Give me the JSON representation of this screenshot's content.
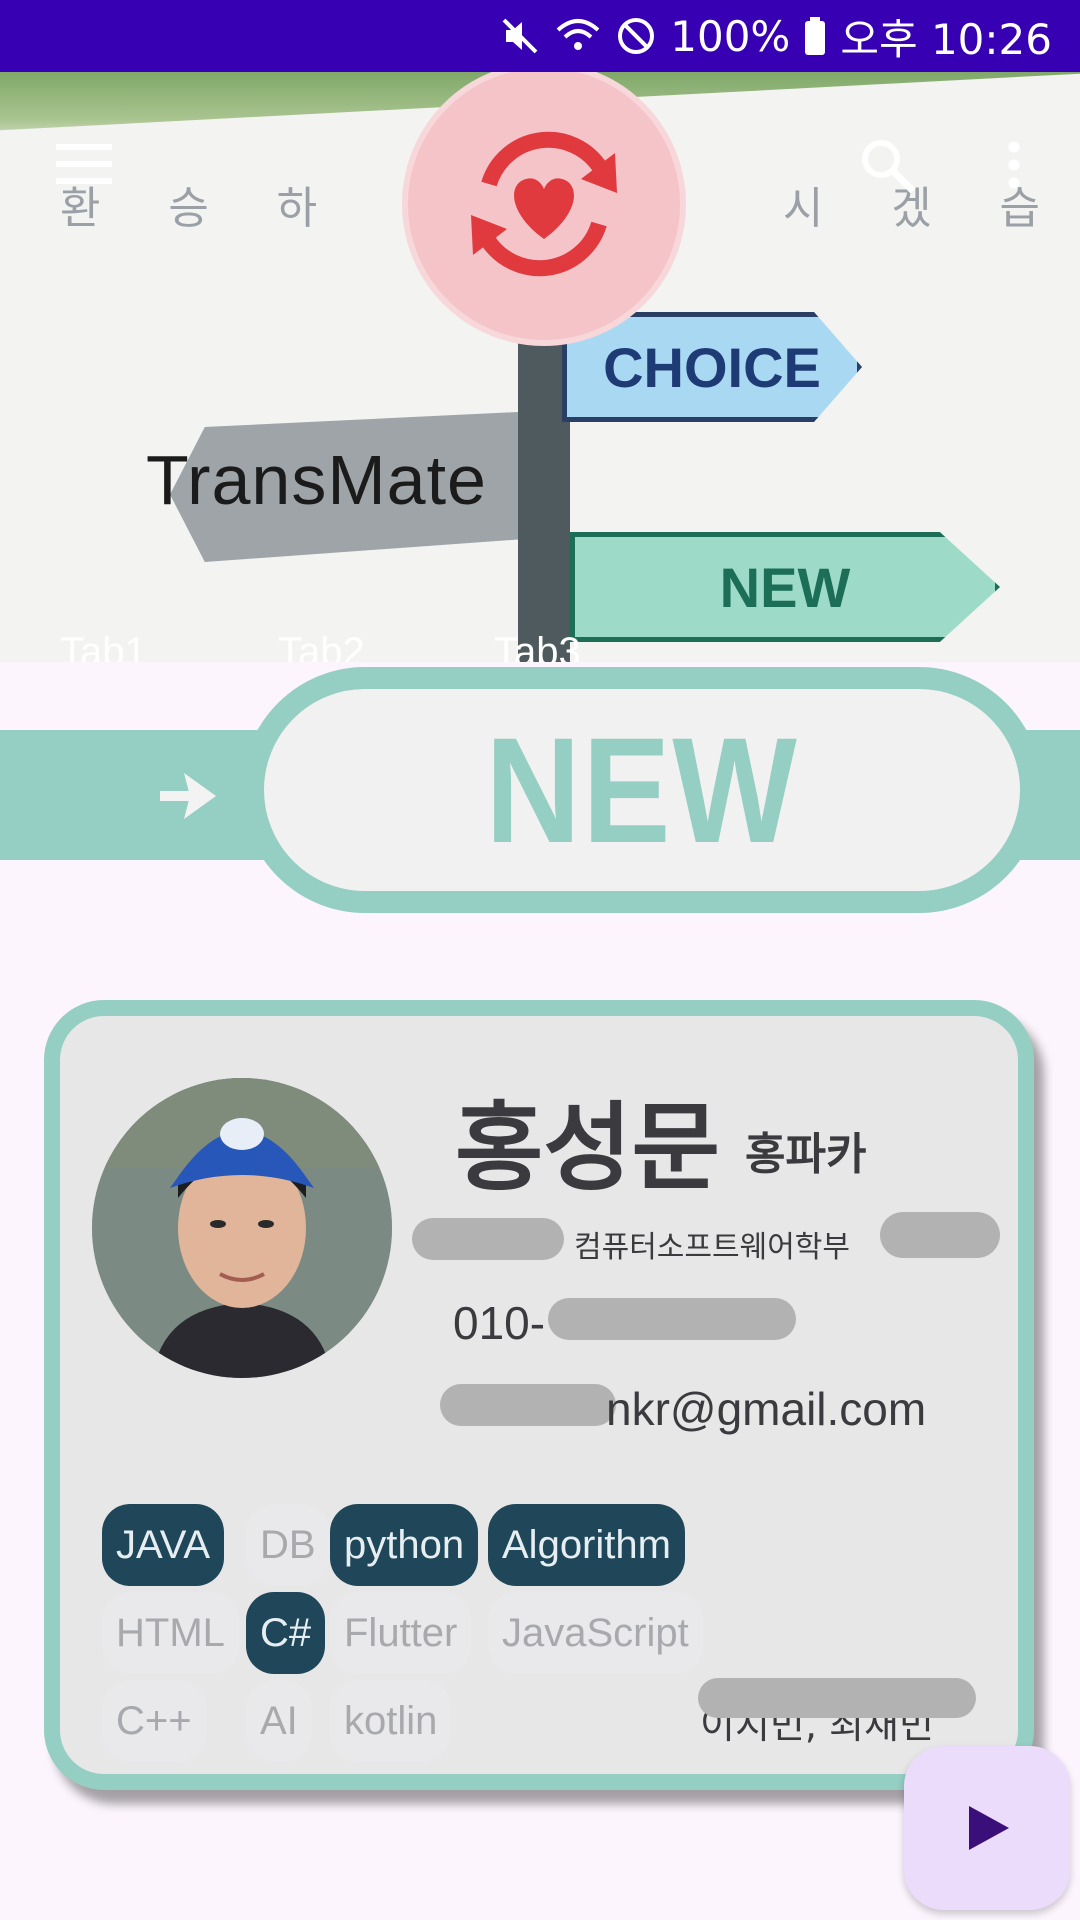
{
  "status_bar": {
    "battery": "100%",
    "time": "오후 10:26",
    "icons": [
      "mute-icon",
      "wifi-icon",
      "do-not-disturb-icon",
      "battery-icon"
    ]
  },
  "header": {
    "title": "TransMate",
    "wall_letters": [
      "환",
      "승",
      "하",
      "시",
      "겠",
      "습"
    ],
    "signs": {
      "choice": "CHOICE",
      "new": "NEW"
    },
    "tabs": [
      "Tab1",
      "Tab2",
      "Tab3"
    ]
  },
  "banner": {
    "text": "NEW"
  },
  "profile": {
    "name": "홍성문",
    "nickname": "홍파카",
    "department": "컴퓨터소프트웨어학부",
    "phone": "010-",
    "email": "nkr@gmail.com",
    "footnote": "이지민, 최재민"
  },
  "skills": [
    {
      "label": "JAVA",
      "selected": true
    },
    {
      "label": "DB",
      "selected": false
    },
    {
      "label": "python",
      "selected": true
    },
    {
      "label": "Algorithm",
      "selected": true
    },
    {
      "label": "HTML",
      "selected": false
    },
    {
      "label": "C#",
      "selected": true
    },
    {
      "label": "Flutter",
      "selected": false
    },
    {
      "label": "JavaScript",
      "selected": false
    },
    {
      "label": "C++",
      "selected": false
    },
    {
      "label": "AI",
      "selected": false
    },
    {
      "label": "kotlin",
      "selected": false
    }
  ],
  "colors": {
    "status_bar": "#3700b3",
    "accent": "#95cec2",
    "chip_selected": "#1f4759",
    "fab": "#eadcfa",
    "fab_icon": "#3a0f7a"
  }
}
